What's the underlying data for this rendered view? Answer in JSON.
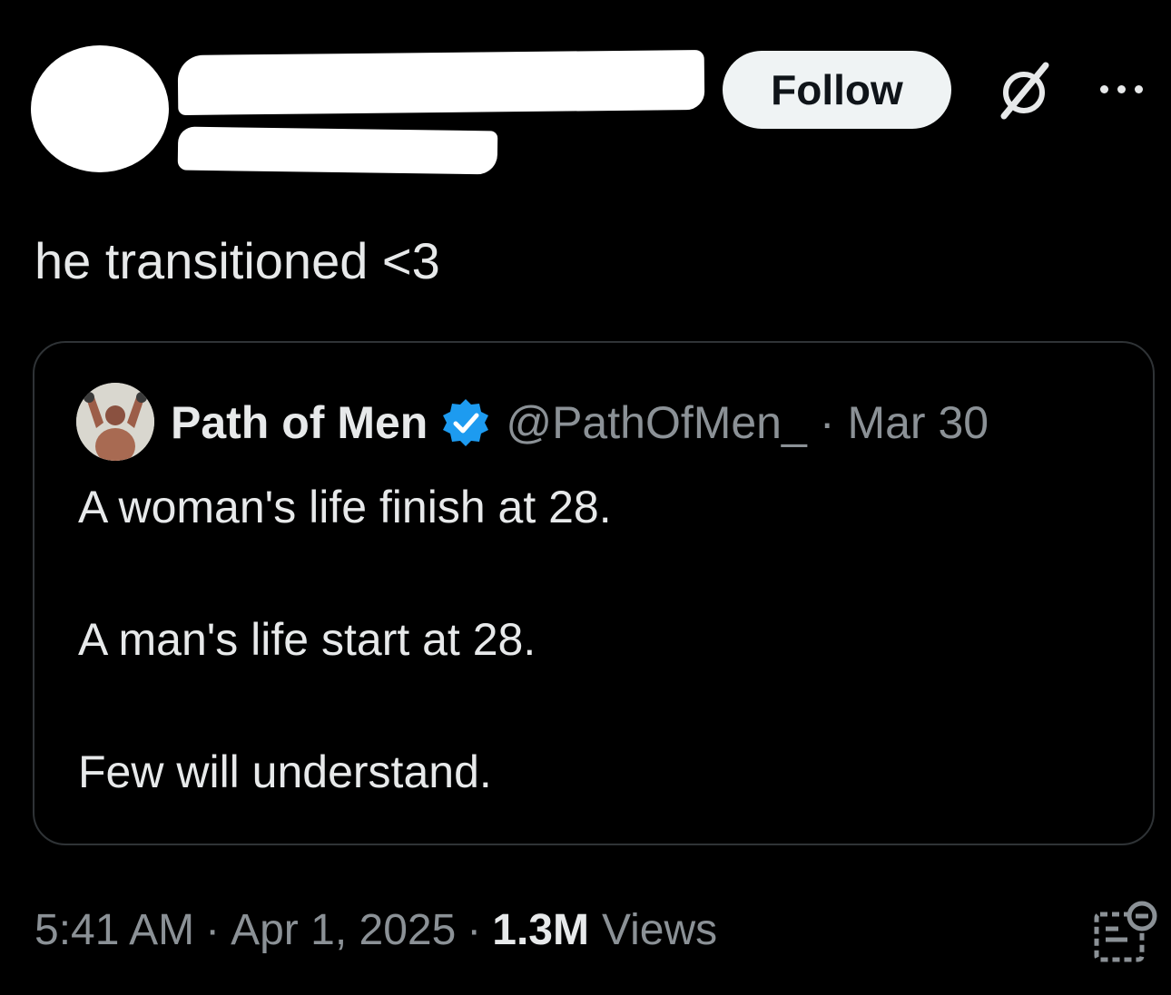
{
  "follow_button": {
    "label": "Follow"
  },
  "icons": {
    "grok": "grok-icon",
    "more": "more-icon",
    "verified": "verified-badge-icon",
    "analytics": "post-analytics-icon"
  },
  "post": {
    "text": "he transitioned <3"
  },
  "quoted_post": {
    "author_name": "Path of Men",
    "author_handle": "@PathOfMen_",
    "separator": "·",
    "date": "Mar 30",
    "lines": [
      "A woman's life finish at 28.",
      "A man's life start at 28.",
      "Few will understand."
    ]
  },
  "meta": {
    "time": "5:41 AM",
    "separator": "·",
    "date": "Apr 1, 2025",
    "views_count": "1.3M",
    "views_label": "Views"
  },
  "colors": {
    "background": "#000000",
    "text": "#e7e9ea",
    "muted": "#8b9196",
    "verified": "#1d9bf0",
    "border": "#2f3336"
  }
}
